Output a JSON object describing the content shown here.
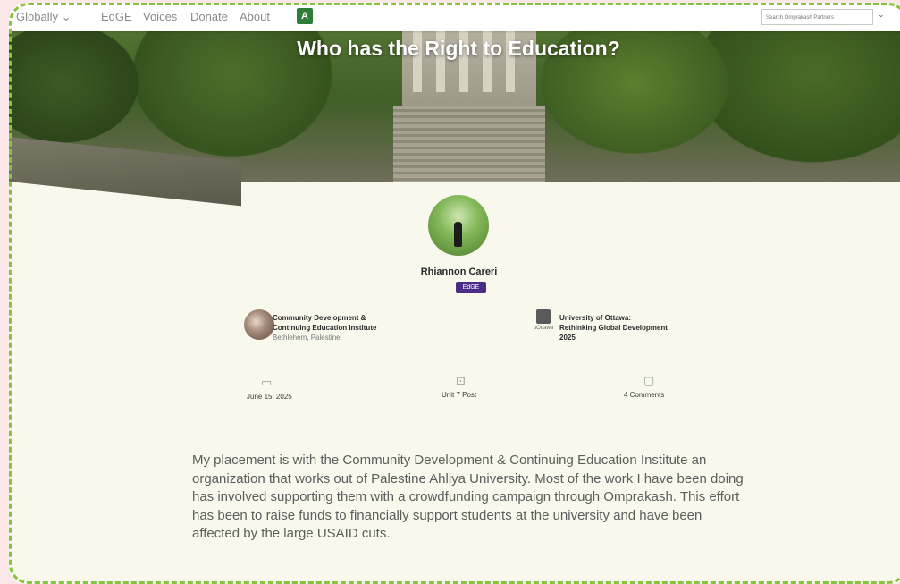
{
  "nav": {
    "items": [
      "Globally ⌄",
      "EdGE",
      "Voices",
      "Donate",
      "About"
    ],
    "translate_icon": "translate-icon",
    "search_placeholder": "Search Omprakash Partners",
    "search_chevron": "⌄"
  },
  "hero": {
    "title": "Who has the Right to Education?"
  },
  "profile": {
    "name": "Rhiannon Careri",
    "badge": "EdGE"
  },
  "orgs": [
    {
      "line1": "Community Development &",
      "line2": "Continuing Education Institute",
      "sub": "Bethlehem, Palestine"
    },
    {
      "line1": "University of Ottawa:",
      "line2": "Rethinking Global Development",
      "sub": "2025",
      "logo_text": "uOttawa"
    }
  ],
  "meta": {
    "date": "June 15, 2025",
    "unit": "Unit 7 Post",
    "comments": "4 Comments"
  },
  "body": {
    "text": "My placement is with the Community Development & Continuing Education Institute an organization that works out of Palestine Ahliya University. Most of the work I have been doing has involved supporting them with a crowdfunding campaign through Omprakash. This effort has been to raise funds to financially support students at the university and have been affected by the large USAID cuts."
  },
  "colors": {
    "accent_green": "#86c440",
    "badge_purple": "#4b2c86",
    "page_bg": "#f8f8ec"
  }
}
